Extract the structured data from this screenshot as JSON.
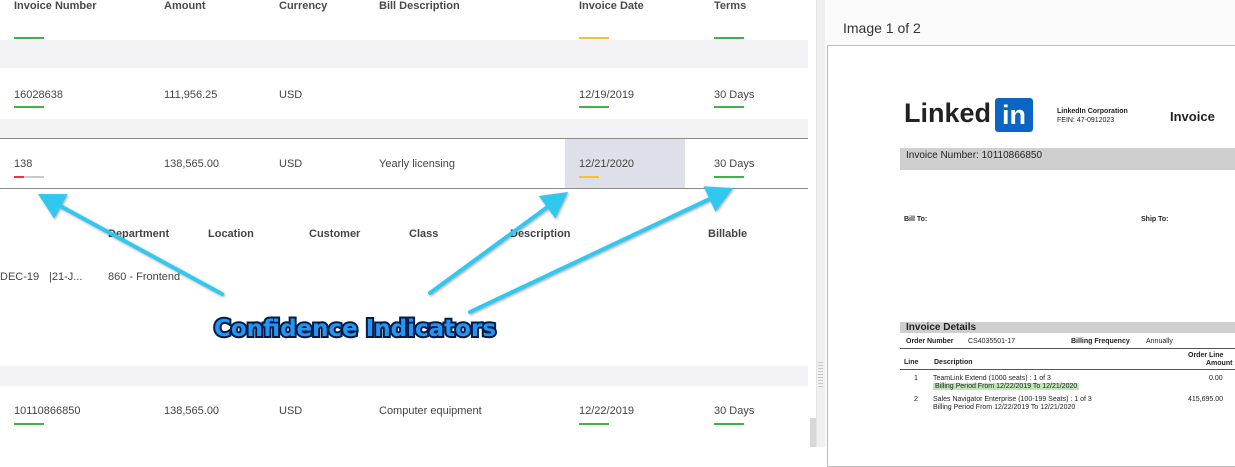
{
  "table": {
    "headers": [
      "Invoice Number",
      "Amount",
      "Currency",
      "Bill Description",
      "Invoice Date",
      "Terms"
    ],
    "rows": [
      {
        "invoice_number": "16028638",
        "amount": "111,956.25",
        "currency": "USD",
        "bill_description": "",
        "invoice_date": "12/19/2019",
        "terms": "30 Days"
      },
      {
        "invoice_number": "138",
        "amount": "138,565.00",
        "currency": "USD",
        "bill_description": "Yearly licensing",
        "invoice_date": "12/21/2020",
        "terms": "30 Days"
      },
      {
        "invoice_number": "10110866850",
        "amount": "138,565.00",
        "currency": "USD",
        "bill_description": "Computer equipment",
        "invoice_date": "12/22/2019",
        "terms": "30 Days"
      }
    ],
    "sub_headers": [
      "Department",
      "Location",
      "Customer",
      "Class",
      "Description",
      "Billable"
    ],
    "sub_row": {
      "col1": "DEC-19",
      "col2": "|21-J...",
      "col3": "860 - Frontend"
    },
    "indicator_colors": {
      "high": "#3db34a",
      "medium": "#f2c230",
      "low": "#e53935"
    }
  },
  "annotation": {
    "label": "Confidence Indicators",
    "arrow_color": "#33c7ee"
  },
  "viewer": {
    "title": "Image 1 of 2",
    "doc": {
      "logo_text": "Linked",
      "logo_box": "in",
      "company": "LinkedIn Corporation",
      "fein": "FEIN: 47-0912023",
      "doc_type": "Invoice",
      "invoice_number_line": "Invoice Number: 10110866850",
      "bill_to": "Bill To:",
      "ship_to": "Ship To:",
      "details_title": "Invoice Details",
      "order_number_label": "Order Number",
      "order_number": "CS4035501-17",
      "billing_freq_label": "Billing Frequency",
      "billing_freq": "Annually",
      "col_line": "Line",
      "col_desc": "Description",
      "col_amount_1": "Order Line",
      "col_amount_2": "Amount",
      "lines": [
        {
          "no": "1",
          "desc": "TeamLink Extend (1000 seats)   : 1 of 3",
          "period": "Billing Period From 12/22/2019 To 12/21/2020",
          "amount": "0.00"
        },
        {
          "no": "2",
          "desc": "Sales Navigator Enterprise (100-199 Seats)   : 1 of 3",
          "period": "Billing Period From 12/22/2019 To 12/21/2020",
          "amount": "415,695.00"
        }
      ]
    }
  }
}
